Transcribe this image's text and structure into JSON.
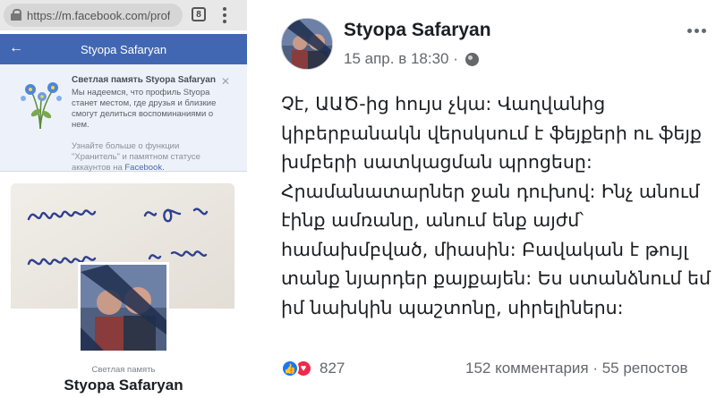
{
  "browser": {
    "url": "https://m.facebook.com/prof",
    "tab_count": "8"
  },
  "mobile_header": {
    "title": "Styopa Safaryan"
  },
  "memorial_card": {
    "title": "Светлая память Styopa Safaryan",
    "body": "Мы надеемся, что профиль Styopa станет местом, где друзья и близкие смогут делиться воспоминаниями о нем.",
    "learn_more_prefix": "Узнайте больше о функции \"Хранитель\" и памятном статусе аккаунтов на ",
    "learn_more_link": "Facebook."
  },
  "profile": {
    "memorial_label": "Светлая память",
    "name": "Styopa Safaryan"
  },
  "post": {
    "author": "Styopa Safaryan",
    "timestamp": "15 апр. в 18:30 ·",
    "text": "Չէ, ԱԱԾ-ից հույս չկա: Վաղվանից կիբերբանակն վերսկսում է ֆեյքերի ու ֆեյք խմբերի սատկացման պրոցեսը: Հրամանատարներ ջան դուխով: Ինչ անում էինք ամռանը, անում ենք այժմ՝ համախմբված, միասին: Բավական է թույլ տանք նյարդեր քայքայեն: Ես ստանձնում եմ իմ նախկին պաշտոնը, սիրելիներս:",
    "reaction_count": "827",
    "engagement": "152 комментария · 55 репостов"
  },
  "colors": {
    "facebook_blue": "#4267b2",
    "like_blue": "#1877f2",
    "love_red": "#f0284a"
  }
}
